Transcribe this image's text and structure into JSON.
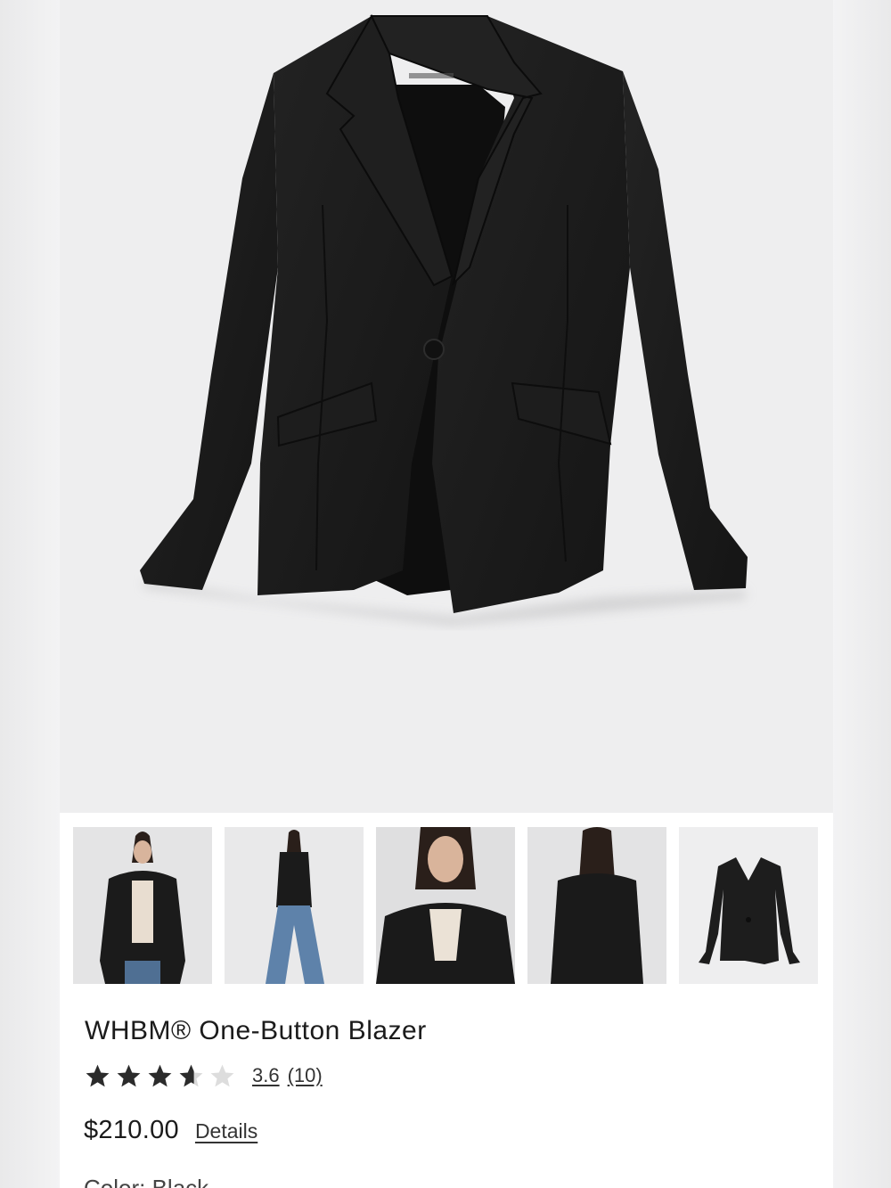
{
  "product": {
    "title": "WHBM® One-Button Blazer",
    "rating": {
      "value_label": "3.6",
      "count_label": "(10)",
      "stars_total": 5,
      "stars_filled": 3.6
    },
    "price": "$210.00",
    "details_label": "Details",
    "color_label": "Color: Black"
  },
  "gallery": {
    "main_image": "black-blazer-flat-lay",
    "thumbnails": [
      {
        "name": "model-front-open-blazer"
      },
      {
        "name": "model-full-length-jeans"
      },
      {
        "name": "model-closeup-blazer"
      },
      {
        "name": "model-back-view"
      },
      {
        "name": "blazer-flat-lay"
      }
    ]
  },
  "colors": {
    "hero_bg": "#eeeeef",
    "garment": "#1c1c1c",
    "star_filled": "#2b2b2b",
    "star_empty": "#d9d9d9"
  }
}
